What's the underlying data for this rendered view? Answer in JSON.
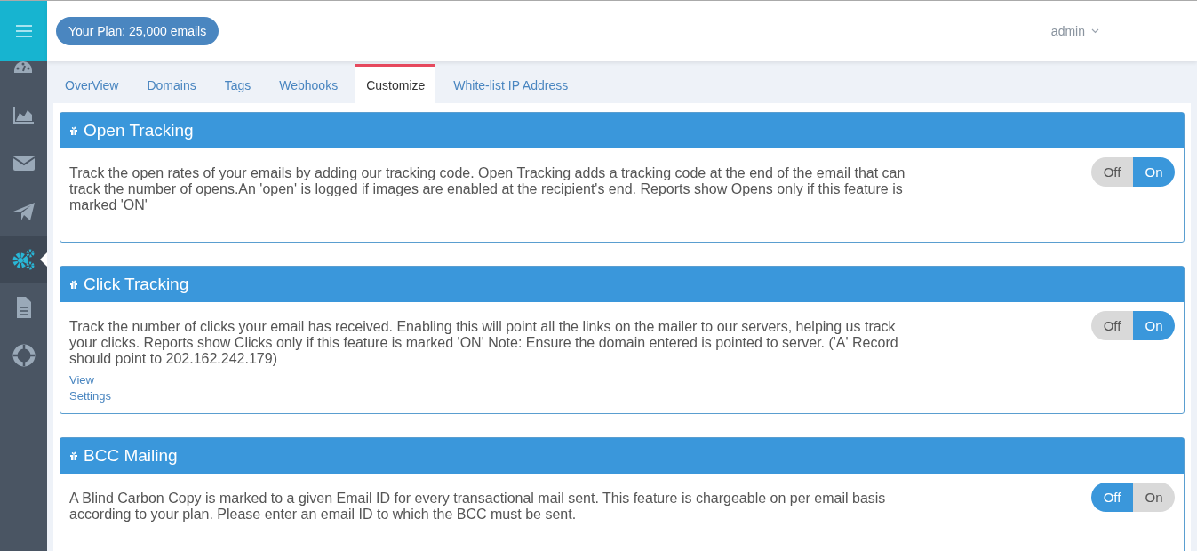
{
  "sidebar": {
    "items": [
      {
        "kind": "gauge",
        "selected": false
      },
      {
        "kind": "chart",
        "selected": false
      },
      {
        "kind": "mail",
        "selected": false
      },
      {
        "kind": "plane",
        "selected": false
      },
      {
        "kind": "gears",
        "selected": true
      },
      {
        "kind": "doc",
        "selected": false
      },
      {
        "kind": "lifebuoy",
        "selected": false
      }
    ]
  },
  "header": {
    "plan": "Your Plan: 25,000 emails",
    "user": "admin"
  },
  "tabs": [
    {
      "label": "OverView",
      "selected": false
    },
    {
      "label": "Domains",
      "selected": false
    },
    {
      "label": "Tags",
      "selected": false
    },
    {
      "label": "Webhooks",
      "selected": false
    },
    {
      "label": "Customize",
      "selected": true
    },
    {
      "label": "White-list IP Address",
      "selected": false
    }
  ],
  "cards": [
    {
      "title": "Open Tracking",
      "text": "Track the open rates of your emails by adding our tracking code. Open Tracking adds a tracking code at the end of the email that can track the number of opens.An 'open' is logged if images are enabled at the recipient's end. Reports show Opens only if this feature is marked 'ON'",
      "off_label": "Off",
      "on_label": "On",
      "on": true
    },
    {
      "title": "Click Tracking",
      "text": "Track the number of clicks your email has received. Enabling this will point all the links on the mailer to our servers, helping us track your clicks. Reports show Clicks only if this feature is marked 'ON' Note: Ensure the domain entered is pointed to server. ('A' Record should point to 202.162.242.179)",
      "links": [
        "View",
        "Settings"
      ],
      "off_label": "Off",
      "on_label": "On",
      "on": true
    },
    {
      "title": "BCC Mailing",
      "text": "A Blind Carbon Copy is marked to a given Email ID for every transactional mail sent. This feature is chargeable on per email basis according to your plan. Please enter an email ID to which the BCC must be sent.",
      "off_label": "Off",
      "on_label": "On",
      "on": false
    }
  ]
}
